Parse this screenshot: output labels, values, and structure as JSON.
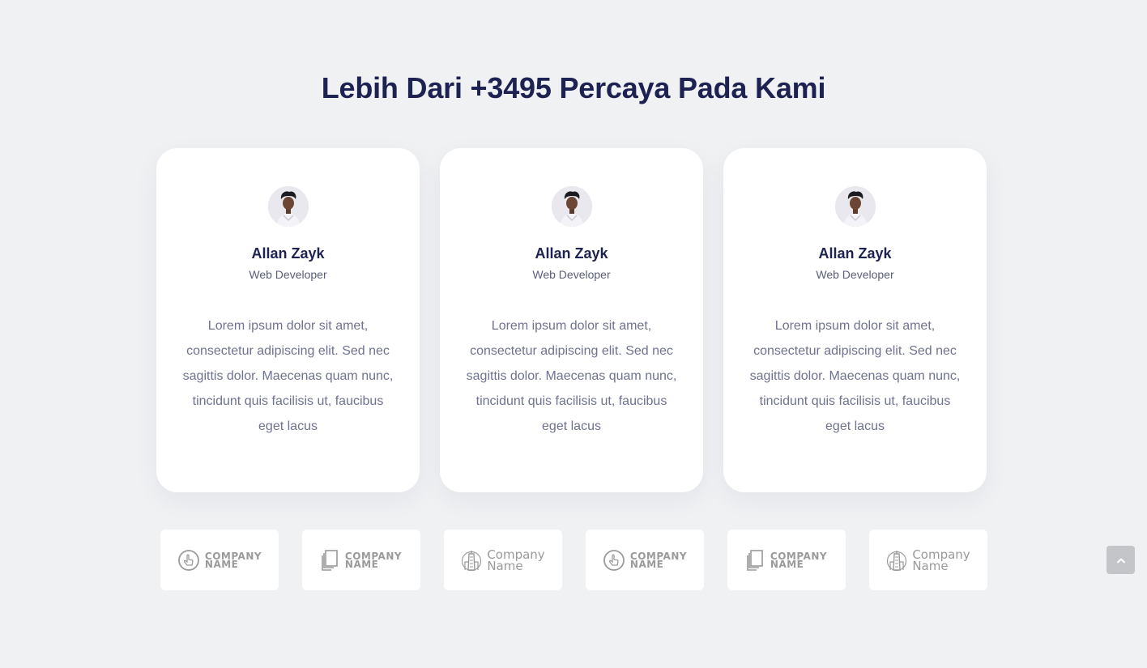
{
  "section": {
    "title": "Lebih Dari +3495 Percaya Pada Kami"
  },
  "testimonials": [
    {
      "name": "Allan Zayk",
      "role": "Web Developer",
      "text": "Lorem ipsum dolor sit amet, consectetur adipiscing elit. Sed nec sagittis dolor. Maecenas quam nunc, tincidunt quis facilisis ut, faucibus eget lacus"
    },
    {
      "name": "Allan Zayk",
      "role": "Web Developer",
      "text": "Lorem ipsum dolor sit amet, consectetur adipiscing elit. Sed nec sagittis dolor. Maecenas quam nunc, tincidunt quis facilisis ut, faucibus eget lacus"
    },
    {
      "name": "Allan Zayk",
      "role": "Web Developer",
      "text": "Lorem ipsum dolor sit amet, consectetur adipiscing elit. Sed nec sagittis dolor. Maecenas quam nunc, tincidunt quis facilisis ut, faucibus eget lacus"
    }
  ],
  "logos": [
    {
      "icon": "pointer-hand-icon",
      "line1": "COMPANY",
      "line2": "NAME"
    },
    {
      "icon": "documents-icon",
      "line1": "COMPANY",
      "line2": "NAME"
    },
    {
      "icon": "building-icon",
      "line1": "Company",
      "line2": "Name"
    },
    {
      "icon": "pointer-hand-icon",
      "line1": "COMPANY",
      "line2": "NAME"
    },
    {
      "icon": "documents-icon",
      "line1": "COMPANY",
      "line2": "NAME"
    },
    {
      "icon": "building-icon",
      "line1": "Company",
      "line2": "Name"
    }
  ],
  "scroll_top": {
    "icon": "chevron-up-icon"
  },
  "colors": {
    "background": "#f0f1f3",
    "heading": "#1e2252",
    "body_text": "#6f7290",
    "logo_gray": "#9a9a9a"
  }
}
